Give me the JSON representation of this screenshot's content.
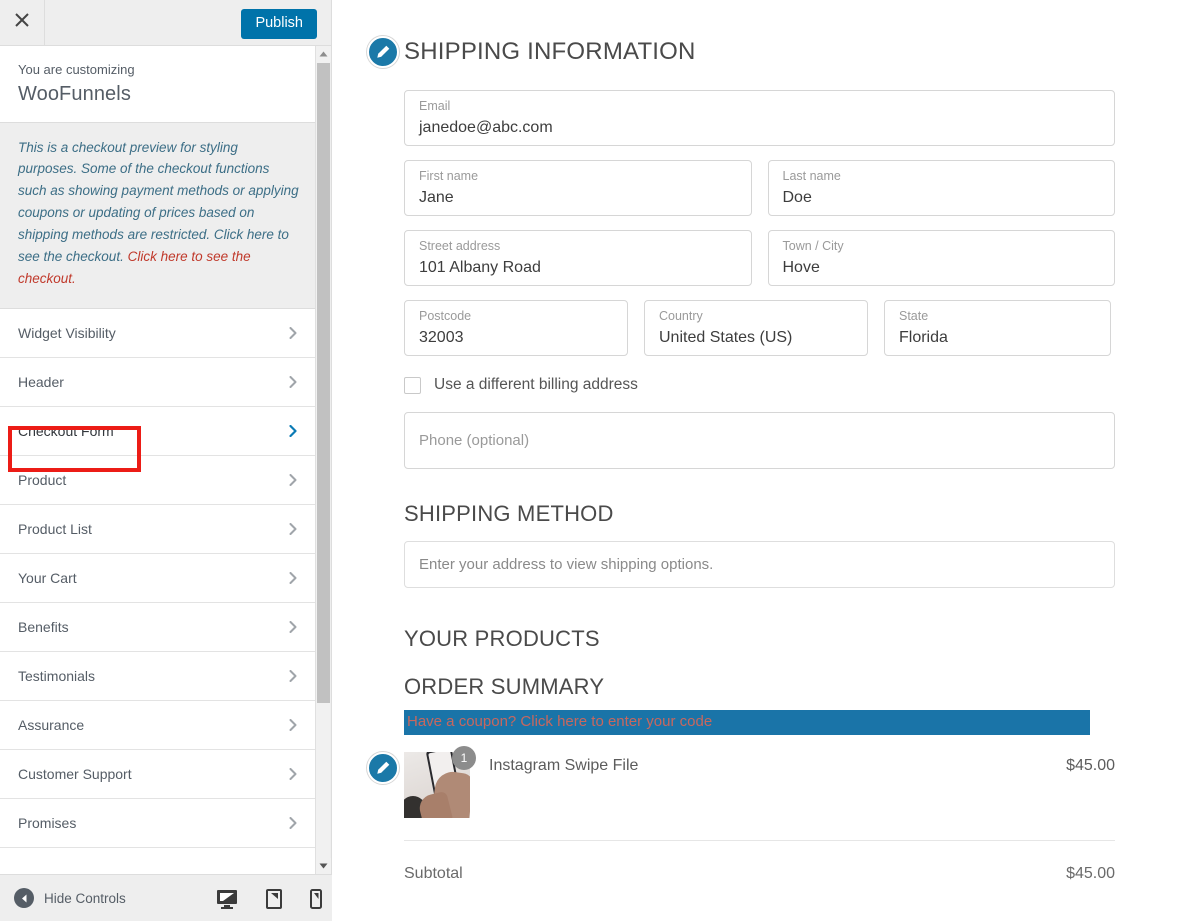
{
  "customizer": {
    "close_icon": "close-icon",
    "publish_label": "Publish",
    "customizing_label": "You are customizing",
    "site_title": "WooFunnels",
    "notice_text": "This is a checkout preview for styling purposes. Some of the checkout functions such as showing payment methods or applying coupons or updating of prices based on shipping methods are restricted. Click here to see the checkout. ",
    "notice_link": "Click here to see the checkout.",
    "hide_controls_label": "Hide Controls",
    "devices": [
      {
        "name": "desktop-preview-button"
      },
      {
        "name": "tablet-preview-button"
      },
      {
        "name": "mobile-preview-button"
      }
    ],
    "menu_items": [
      {
        "label": "Widget Visibility",
        "active": false
      },
      {
        "label": "Header",
        "active": false
      },
      {
        "label": "Checkout Form",
        "active": true
      },
      {
        "label": "Product",
        "active": false
      },
      {
        "label": "Product List",
        "active": false
      },
      {
        "label": "Your Cart",
        "active": false
      },
      {
        "label": "Benefits",
        "active": false
      },
      {
        "label": "Testimonials",
        "active": false
      },
      {
        "label": "Assurance",
        "active": false
      },
      {
        "label": "Customer Support",
        "active": false
      },
      {
        "label": "Promises",
        "active": false
      }
    ]
  },
  "checkout": {
    "shipping_heading": "SHIPPING INFORMATION",
    "fields": {
      "email": {
        "label": "Email",
        "value": "janedoe@abc.com"
      },
      "first_name": {
        "label": "First name",
        "value": "Jane"
      },
      "last_name": {
        "label": "Last name",
        "value": "Doe"
      },
      "street": {
        "label": "Street address",
        "value": "101 Albany Road"
      },
      "city": {
        "label": "Town / City",
        "value": "Hove"
      },
      "postcode": {
        "label": "Postcode",
        "value": "32003"
      },
      "country": {
        "label": "Country",
        "value": "United States (US)"
      },
      "state": {
        "label": "State",
        "value": "Florida"
      },
      "phone": {
        "placeholder": "Phone (optional)",
        "value": ""
      }
    },
    "billing_checkbox_label": "Use a different billing address",
    "shipping_method_heading": "SHIPPING METHOD",
    "shipping_method_placeholder": "Enter your address to view shipping options.",
    "your_products_heading": "YOUR PRODUCTS",
    "order_summary_heading": "ORDER SUMMARY",
    "coupon_text": "Have a coupon? Click here to enter your code",
    "product": {
      "name": "Instagram Swipe File",
      "price": "$45.00",
      "quantity": "1"
    },
    "subtotal_label": "Subtotal",
    "subtotal_value": "$45.00"
  },
  "colors": {
    "publish_blue": "#0073aa",
    "edit_badge_blue": "#1b79a8",
    "coupon_highlight_bg": "#1a74a8",
    "coupon_text": "#c8675e",
    "annotation_red": "#ec1c16",
    "notice_text": "#3c6e86",
    "notice_link_red": "#c0392b"
  }
}
